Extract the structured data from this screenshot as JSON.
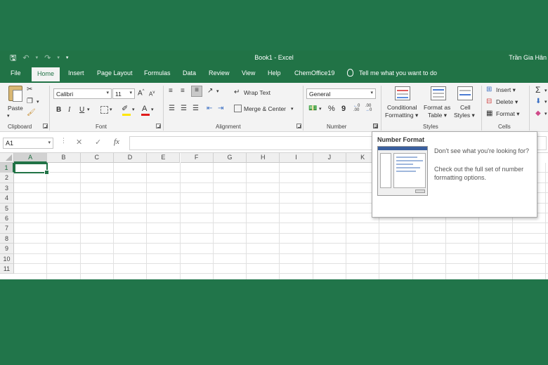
{
  "titlebar": {
    "document_title": "Book1  -  Excel",
    "user_name": "Trần Gia Hân"
  },
  "tabs": [
    "File",
    "Home",
    "Insert",
    "Page Layout",
    "Formulas",
    "Data",
    "Review",
    "View",
    "Help",
    "ChemOffice19"
  ],
  "tell_me": "Tell me what you want to do",
  "clipboard": {
    "paste_label": "Paste",
    "group_label": "Clipboard"
  },
  "font": {
    "name": "Calibri",
    "size": "11",
    "group_label": "Font",
    "bold": "B",
    "italic": "I",
    "underline": "U",
    "grow": "A",
    "shrink": "A"
  },
  "alignment": {
    "wrap_text": "Wrap Text",
    "merge_center": "Merge & Center",
    "group_label": "Alignment"
  },
  "number": {
    "format": "General",
    "percent": "%",
    "comma": "9",
    "inc_decimal": ".00",
    "dec_decimal": ".00",
    "group_label": "Number"
  },
  "styles": {
    "conditional_1": "Conditional",
    "conditional_2": "Formatting",
    "format_table_1": "Format as",
    "format_table_2": "Table",
    "cell_styles_1": "Cell",
    "cell_styles_2": "Styles",
    "group_label": "Styles"
  },
  "cells": {
    "insert": "Insert",
    "delete": "Delete",
    "format": "Format",
    "group_label": "Cells"
  },
  "formula_bar": {
    "name_box": "A1",
    "cancel": "✕",
    "enter": "✓",
    "fx": "fx"
  },
  "columns": [
    "A",
    "B",
    "C",
    "D",
    "E",
    "F",
    "G",
    "H",
    "I",
    "J",
    "K"
  ],
  "rows": [
    "1",
    "2",
    "3",
    "4",
    "5",
    "6",
    "7",
    "8",
    "9",
    "10",
    "11"
  ],
  "tooltip": {
    "title": "Number Format",
    "line1": "Don't see what you're looking for?",
    "line2": "Check out the full set of number formatting options."
  },
  "colors": {
    "excel_green": "#217346",
    "background": "#21754a",
    "ribbon": "#f3f3f3"
  }
}
